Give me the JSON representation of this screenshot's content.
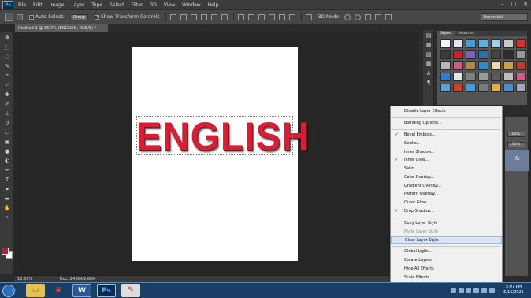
{
  "menubar": {
    "logo": "Ps",
    "items": [
      "File",
      "Edit",
      "Image",
      "Layer",
      "Type",
      "Select",
      "Filter",
      "3D",
      "View",
      "Window",
      "Help"
    ],
    "window_controls": [
      "–",
      "□",
      "✕"
    ]
  },
  "options": {
    "auto_select_label": "Auto-Select:",
    "auto_select_value": "Group",
    "show_transform_label": "Show Transform Controls",
    "mode_3d": "3D Mode:",
    "workspace": "Essentials"
  },
  "document": {
    "tab_title": "Untitled-1 @ 16.7% (ENGLISH, RGB/8) *",
    "canvas_text": "ENGLISH",
    "zoom": "16.67%",
    "doc_size": "Doc: 24.0M/2.60M"
  },
  "panels": {
    "tabs": [
      "Styles",
      "Swatches"
    ],
    "opacity_value": "100%",
    "fill_value": "100%",
    "layer_fx": "fx",
    "style_swatch_colors": [
      "#f4f4f4",
      "#dfe8f0",
      "#3f9de0",
      "#5ab2e8",
      "#9ed1f0",
      "#c8c8c8",
      "#d9302a",
      "#3a3a3a",
      "#d01d2a",
      "#7b5fb8",
      "#2a6fb0",
      "#454545",
      "#2d2d2d",
      "#9a9a9a",
      "#b7b7b7",
      "#d25a7a",
      "#b5854d",
      "#2b8ad1",
      "#e8d8b0",
      "#c9a24b",
      "#c43a2a",
      "#2c7ecf",
      "#e6e6e6",
      "#7f7f7f",
      "#9a9a9a",
      "#5b5b5b",
      "#bdbdbd",
      "#d35a8a",
      "#5aa0dc",
      "#d73b2a",
      "#3b9fe0",
      "#7a7a7a",
      "#e1b04a",
      "#4b8ad1",
      "#a5a5c0"
    ]
  },
  "context_menu": {
    "items": [
      {
        "label": "Disable Layer Effects",
        "checked": false,
        "disabled": false
      },
      {
        "label": "Blending Options...",
        "checked": false,
        "disabled": false
      },
      {
        "label": "Bevel  Emboss...",
        "checked": true,
        "disabled": false
      },
      {
        "label": "Stroke...",
        "checked": false,
        "disabled": false
      },
      {
        "label": "Inner Shadow...",
        "checked": false,
        "disabled": false
      },
      {
        "label": "Inner Glow...",
        "checked": true,
        "disabled": false
      },
      {
        "label": "Satin...",
        "checked": false,
        "disabled": false
      },
      {
        "label": "Color Overlay...",
        "checked": false,
        "disabled": false
      },
      {
        "label": "Gradient Overlay...",
        "checked": false,
        "disabled": false
      },
      {
        "label": "Pattern Overlay...",
        "checked": false,
        "disabled": false
      },
      {
        "label": "Outer Glow...",
        "checked": false,
        "disabled": false
      },
      {
        "label": "Drop Shadow...",
        "checked": true,
        "disabled": false
      },
      {
        "label": "Copy Layer Style",
        "checked": false,
        "disabled": false
      },
      {
        "label": "Paste Layer Style",
        "checked": false,
        "disabled": true
      },
      {
        "label": "Clear Layer Style",
        "checked": false,
        "disabled": false,
        "highlighted": true
      },
      {
        "label": "Global Light...",
        "checked": false,
        "disabled": false
      },
      {
        "label": "Create Layers",
        "checked": false,
        "disabled": false
      },
      {
        "label": "Hide All Effects",
        "checked": false,
        "disabled": false
      },
      {
        "label": "Scale Effects...",
        "checked": false,
        "disabled": false
      }
    ]
  },
  "taskbar": {
    "apps": [
      "ie",
      "explorer",
      "chrome",
      "word",
      "photoshop",
      "paint"
    ],
    "time": "5:07 PM",
    "date": "6/16/2021"
  }
}
